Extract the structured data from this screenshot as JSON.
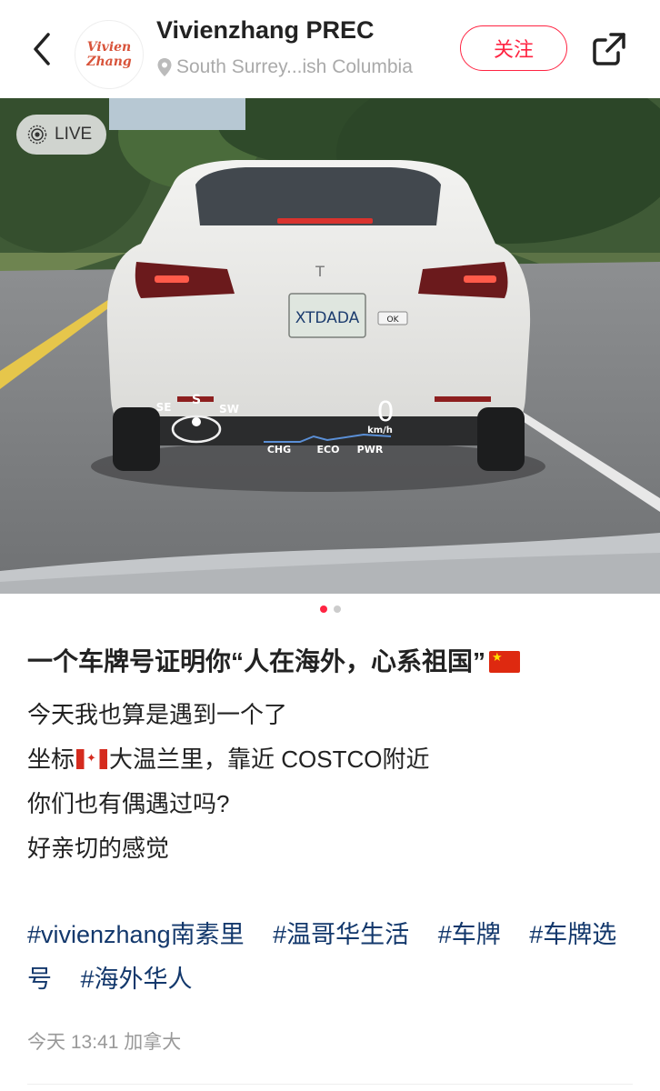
{
  "header": {
    "author_name": "Vivienzhang PREC",
    "location": "South Surrey...ish Columbia",
    "follow_label": "关注",
    "avatar_line1": "Vivien",
    "avatar_line2": "Zhang"
  },
  "media": {
    "live_label": "LIVE",
    "plate_text": "XTDADA",
    "plate_badge": "OK",
    "hud": {
      "speed": "0",
      "unit": "km/h",
      "compass_left": "SE",
      "compass_mid": "S",
      "compass_right": "SW",
      "modes": [
        "CHG",
        "ECO",
        "PWR"
      ]
    },
    "page_index": 1,
    "page_count": 2
  },
  "post": {
    "title": "一个车牌号证明你“人在海外，心系祖国”",
    "lines": [
      "今天我也算是遇到一个了",
      "坐标",
      "大温兰里，靠近 COSTCO附近",
      "你们也有偶遇过吗?",
      "好亲切的感觉"
    ],
    "tags": [
      "#vivienzhang南素里",
      "#温哥华生活",
      "#车牌",
      "#车牌选号",
      "#海外华人"
    ],
    "meta": "今天 13:41 加拿大"
  },
  "icons": {
    "back": "chevron-left-icon",
    "share": "share-icon",
    "location": "location-pin-icon",
    "live": "live-photo-icon",
    "flag_cn": "china-flag-icon",
    "flag_ca": "canada-flag-icon"
  },
  "colors": {
    "accent": "#ff2442",
    "tag": "#13386c"
  }
}
